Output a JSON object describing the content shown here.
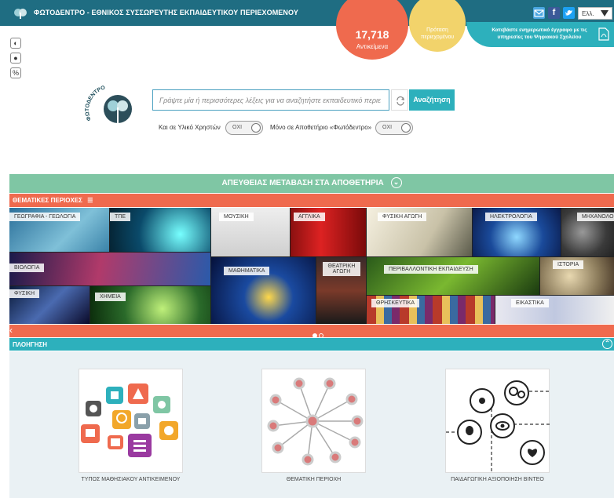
{
  "header": {
    "title": "ΦΩΤΟΔΕΝΤΡΟ - ΕΘΝΙΚΟΣ ΣΥΣΣΩΡΕΥΤΗΣ ΕΚΠΑΙΔΕΥΤΙΚΟΥ ΠΕΡΙΕΧΟΜΕΝΟΥ",
    "language": "Ελλ."
  },
  "stats": {
    "count": "17,718",
    "count_label": "Αντικείμενα",
    "submit_label": "Πρόταση περιεχομένου",
    "doc_label": "Κατεβάστε ενημερωτικό έγγραφο με τις υπηρεσίες του Ψηφιακού Σχολείου"
  },
  "logo_text": "ΦΩΤΟΔΕΝΤΡΟ",
  "search": {
    "placeholder": "Γράψτε μία ή περισσότερες λέξεις για να αναζητήστε εκπαιδευτικό περιε",
    "button": "Αναζήτηση"
  },
  "options": {
    "user_material_label": "Και σε Υλικό Χρηστών",
    "user_material_value": "ΟΧΙ",
    "repo_only_label": "Μόνο σε Αποθετήριο «Φωτόδεντρο»",
    "repo_only_value": "ΟΧΙ"
  },
  "direct_bar": "ΑΠΕΥΘΕΙΑΣ ΜΕΤΑΒΑΣΗ ΣΤΑ ΑΠΟΘΕΤΗΡΙΑ",
  "thematic_bar": "ΘΕΜΑΤΙΚΕΣ ΠΕΡΙΟΧΕΣ",
  "tiles": [
    {
      "label": "ΓΕΩΓΡΑΦΙΑ - ΓΕΩΛΟΓΙΑ"
    },
    {
      "label": "ΤΠΕ"
    },
    {
      "label": "ΜΟΥΣΙΚΗ"
    },
    {
      "label": "ΑΓΓΛΙΚΑ"
    },
    {
      "label": "ΦΥΣΙΚΗ ΑΓΩΓΗ"
    },
    {
      "label": "ΗΛΕΚΤΡΟΛΟΓΙΑ"
    },
    {
      "label": "ΜΗΧΑΝΟΛΟΓ"
    },
    {
      "label": "ΒΙΟΛΟΓΙΑ"
    },
    {
      "label": "ΜΑΘΗΜΑΤΙΚΑ"
    },
    {
      "label": "ΘΕΑΤΡΙΚΗ ΑΓΩΓΗ"
    },
    {
      "label": "ΠΕΡΙΒΑΛΛΟΝΤΙΚΗ ΕΚΠΑΙΔΕΥΣΗ"
    },
    {
      "label": "ΙΣΤΟΡΙΑ"
    },
    {
      "label": "ΦΥΣΙΚΗ"
    },
    {
      "label": "ΧΗΜΕΙΑ"
    },
    {
      "label": "ΘΡΗΣΚΕΥΤΙΚΑ"
    },
    {
      "label": "ΕΙΚΑΣΤΙΚΑ"
    }
  ],
  "browse_bar": "ΠΛΟΗΓΗΣΗ",
  "cards": [
    {
      "label": "ΤΥΠΟΣ ΜΑΘΗΣΙΑΚΟΥ ΑΝΤΙΚΕΙΜΕΝΟΥ"
    },
    {
      "label": "ΘΕΜΑΤΙΚΗ ΠΕΡΙΟΧΗ"
    },
    {
      "label": "ΠΑΙΔΑΓΩΓΙΚΗ ΑΞΙΟΠΟΙΗΣΗ ΒΙΝΤΕΟ"
    }
  ],
  "colors": {
    "header": "#1f6d82",
    "orange": "#ef6a4e",
    "teal": "#2db0bc",
    "green": "#7fc6a4",
    "yellow": "#f2d36b"
  }
}
